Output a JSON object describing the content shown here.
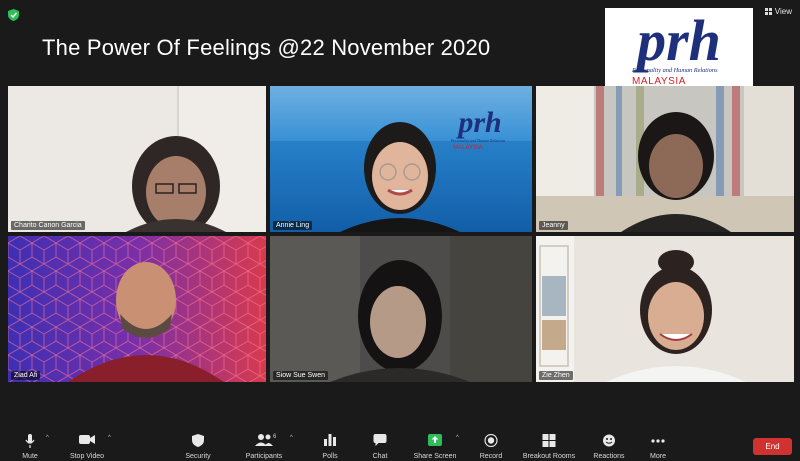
{
  "window": {
    "title": "The Power Of Feelings @22 November 2020",
    "view_label": "View"
  },
  "logo": {
    "mark": "prh",
    "subtitle": "Personality and Human Relations",
    "country": "MALAYSIA"
  },
  "participants": [
    {
      "name": "Charito Canon Garcia"
    },
    {
      "name": "Annie Ling",
      "active_speaker": true,
      "background_logo": {
        "mark": "prh",
        "subtitle": "Personality and Human Relations",
        "country": "MALAYSIA"
      }
    },
    {
      "name": "Jeanny"
    },
    {
      "name": "Ziad Afi"
    },
    {
      "name": "Siow Sue Swen"
    },
    {
      "name": "Zie Zhen"
    }
  ],
  "toolbar": {
    "mute": "Mute",
    "stop_video": "Stop Video",
    "security": "Security",
    "participants": "Participants",
    "participants_count": "6",
    "polls": "Polls",
    "chat": "Chat",
    "share_screen": "Share Screen",
    "record": "Record",
    "breakout_rooms": "Breakout Rooms",
    "reactions": "Reactions",
    "more": "More",
    "end": "End"
  },
  "colors": {
    "active_speaker_border": "#d6e85a",
    "share_screen": "#2ebd59",
    "end_button": "#d0332f",
    "logo_blue": "#1e2f7c",
    "logo_red": "#d11f26"
  }
}
